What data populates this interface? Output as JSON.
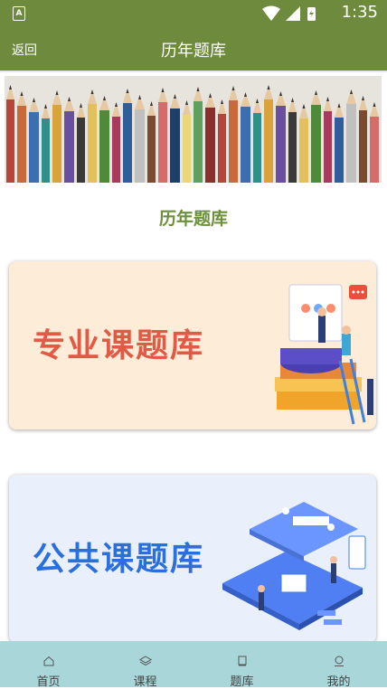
{
  "status_bar": {
    "time": "1:35"
  },
  "header": {
    "back_label": "返回",
    "title": "历年题库"
  },
  "section_title": "历年题库",
  "cards": [
    {
      "label": "专业课题库"
    },
    {
      "label": "公共课题库"
    }
  ],
  "tabs": [
    {
      "label": "首页",
      "icon": "home-icon"
    },
    {
      "label": "课程",
      "icon": "layers-icon"
    },
    {
      "label": "题库",
      "icon": "book-icon"
    },
    {
      "label": "我的",
      "icon": "user-icon"
    }
  ],
  "colors": {
    "primary": "#6e8b3d",
    "tabbar": "#a8d6d9",
    "card1_text": "#e05a45",
    "card2_text": "#2a6fe0"
  }
}
